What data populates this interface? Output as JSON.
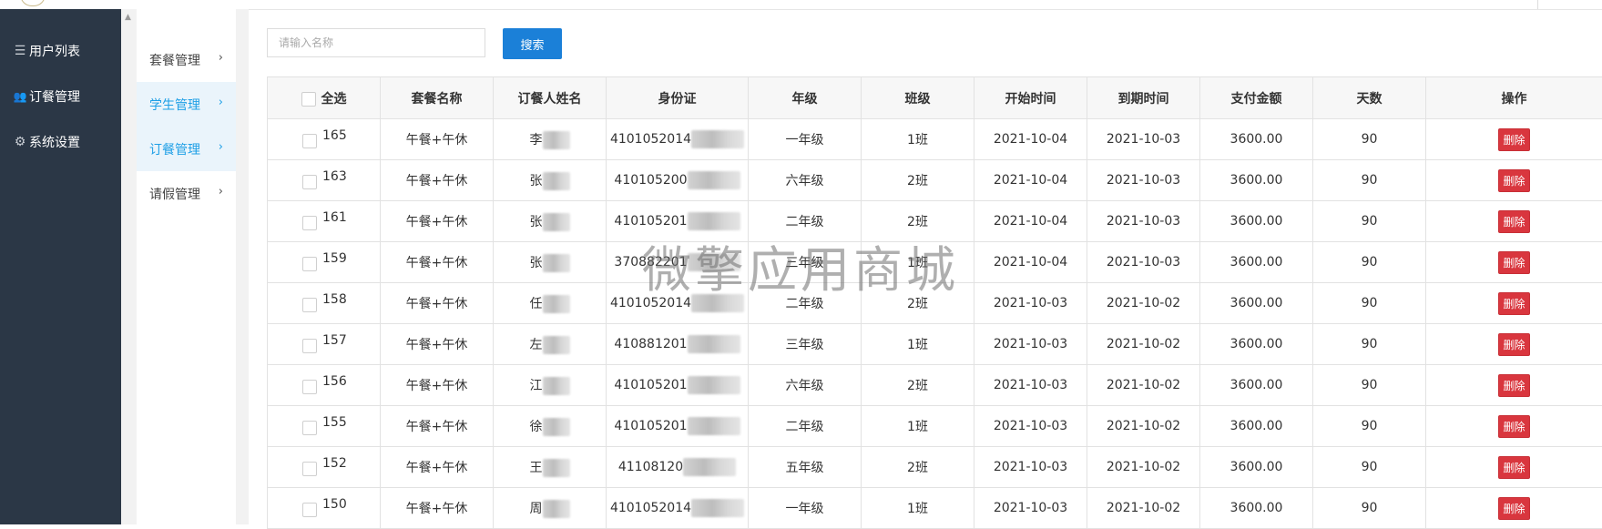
{
  "sidebar": {
    "items": [
      {
        "icon": "list-icon",
        "glyph": "☰",
        "label": "用户列表"
      },
      {
        "icon": "users-icon",
        "glyph": "👥",
        "label": "订餐管理"
      },
      {
        "icon": "gear-icon",
        "glyph": "⚙",
        "label": "系统设置"
      }
    ]
  },
  "subnav": {
    "items": [
      {
        "label": "套餐管理",
        "active": false
      },
      {
        "label": "学生管理",
        "active": true
      },
      {
        "label": "订餐管理",
        "active": true
      },
      {
        "label": "请假管理",
        "active": false
      }
    ]
  },
  "search": {
    "placeholder": "请输入名称",
    "button_label": "搜索"
  },
  "table": {
    "select_all_label": "全选",
    "columns": [
      "套餐名称",
      "订餐人姓名",
      "身份证",
      "年级",
      "班级",
      "开始时间",
      "到期时间",
      "支付金额",
      "天数",
      "操作"
    ],
    "rows": [
      {
        "id": "165",
        "package": "午餐+午休",
        "name": "李",
        "id_card": "4101052014",
        "grade": "一年级",
        "class": "1班",
        "start": "2021-10-04",
        "end": "2021-10-03",
        "amount": "3600.00",
        "days": "90",
        "action": "删除"
      },
      {
        "id": "163",
        "package": "午餐+午休",
        "name": "张",
        "id_card": "410105200",
        "grade": "六年级",
        "class": "2班",
        "start": "2021-10-04",
        "end": "2021-10-03",
        "amount": "3600.00",
        "days": "90",
        "action": "删除"
      },
      {
        "id": "161",
        "package": "午餐+午休",
        "name": "张",
        "id_card": "410105201",
        "grade": "二年级",
        "class": "2班",
        "start": "2021-10-04",
        "end": "2021-10-03",
        "amount": "3600.00",
        "days": "90",
        "action": "删除"
      },
      {
        "id": "159",
        "package": "午餐+午休",
        "name": "张",
        "id_card": "370882201",
        "grade": "三年级",
        "class": "1班",
        "start": "2021-10-04",
        "end": "2021-10-03",
        "amount": "3600.00",
        "days": "90",
        "action": "删除"
      },
      {
        "id": "158",
        "package": "午餐+午休",
        "name": "任",
        "id_card": "4101052014",
        "grade": "二年级",
        "class": "2班",
        "start": "2021-10-03",
        "end": "2021-10-02",
        "amount": "3600.00",
        "days": "90",
        "action": "删除"
      },
      {
        "id": "157",
        "package": "午餐+午休",
        "name": "左",
        "id_card": "410881201",
        "grade": "三年级",
        "class": "1班",
        "start": "2021-10-03",
        "end": "2021-10-02",
        "amount": "3600.00",
        "days": "90",
        "action": "删除"
      },
      {
        "id": "156",
        "package": "午餐+午休",
        "name": "江",
        "id_card": "410105201",
        "grade": "六年级",
        "class": "2班",
        "start": "2021-10-03",
        "end": "2021-10-02",
        "amount": "3600.00",
        "days": "90",
        "action": "删除"
      },
      {
        "id": "155",
        "package": "午餐+午休",
        "name": "徐",
        "id_card": "410105201",
        "grade": "二年级",
        "class": "1班",
        "start": "2021-10-03",
        "end": "2021-10-02",
        "amount": "3600.00",
        "days": "90",
        "action": "删除"
      },
      {
        "id": "152",
        "package": "午餐+午休",
        "name": "王",
        "id_card": "41108120",
        "grade": "五年级",
        "class": "2班",
        "start": "2021-10-03",
        "end": "2021-10-02",
        "amount": "3600.00",
        "days": "90",
        "action": "删除"
      },
      {
        "id": "150",
        "package": "午餐+午休",
        "name": "周",
        "id_card": "4101052014",
        "grade": "一年级",
        "class": "1班",
        "start": "2021-10-03",
        "end": "2021-10-02",
        "amount": "3600.00",
        "days": "90",
        "action": "删除"
      }
    ]
  },
  "watermark": "微擎应用商城",
  "colors": {
    "sidebar_bg": "#2b3746",
    "accent": "#1b80d8",
    "active_text": "#1e9fe6",
    "delete": "#d9363e"
  }
}
